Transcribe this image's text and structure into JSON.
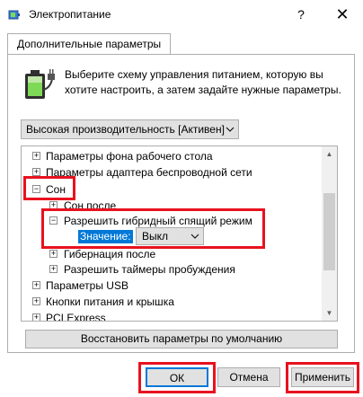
{
  "window": {
    "title": "Электропитание",
    "help_label": "?",
    "close_label": "✕"
  },
  "tab": {
    "label": "Дополнительные параметры"
  },
  "description": "Выберите схему управления питанием, которую вы хотите настроить, а затем задайте нужные параметры.",
  "plan_select": {
    "value": "Высокая производительность [Активен]"
  },
  "tree": {
    "items": [
      {
        "label": "Параметры фона рабочего стола",
        "expander": "+"
      },
      {
        "label": "Параметры адаптера беспроводной сети",
        "expander": "+"
      },
      {
        "label": "Сон",
        "expander": "−"
      },
      {
        "label": "Сон после",
        "expander": "+"
      },
      {
        "label": "Разрешить гибридный спящий режим",
        "expander": "−"
      },
      {
        "label": "Гибернация после",
        "expander": "+"
      },
      {
        "label": "Разрешить таймеры пробуждения",
        "expander": "+"
      },
      {
        "label": "Параметры USB",
        "expander": "+"
      },
      {
        "label": "Кнопки питания и крышка",
        "expander": "+"
      },
      {
        "label": "PCI Express",
        "expander": "+"
      }
    ],
    "value_label": "Значение:",
    "value_select": "Выкл"
  },
  "restore_button": "Восстановить параметры по умолчанию",
  "buttons": {
    "ok": "ОК",
    "cancel": "Отмена",
    "apply": "Применить"
  },
  "colors": {
    "highlight": "#e8121f",
    "selection": "#0078d7"
  }
}
